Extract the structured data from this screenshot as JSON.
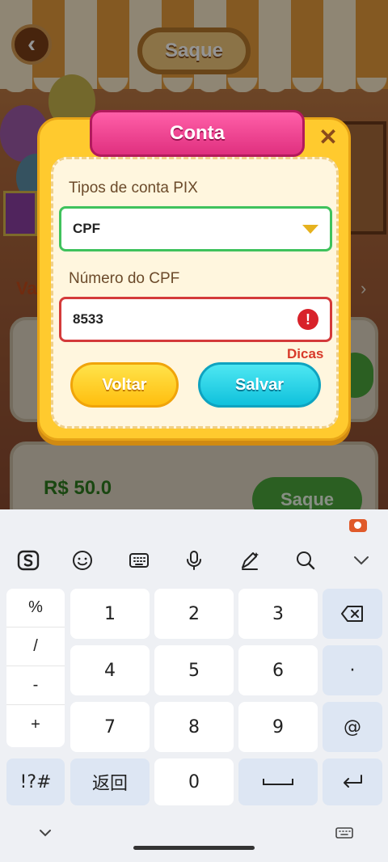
{
  "game": {
    "title": "Saque",
    "partial_label": "Va",
    "card_price": "R$ 50.0",
    "card_button": "Saque"
  },
  "dialog": {
    "title": "Conta",
    "account_type_label": "Tipos de conta PIX",
    "account_type_value": "CPF",
    "cpf_label": "Número do CPF",
    "cpf_value": "8533",
    "hint": "Dicas",
    "back_button": "Voltar",
    "save_button": "Salvar"
  },
  "keyboard": {
    "side_keys": [
      "%",
      "/",
      "-",
      "+"
    ],
    "rows": [
      [
        "1",
        "2",
        "3"
      ],
      [
        "4",
        "5",
        "6"
      ],
      [
        "7",
        "8",
        "9"
      ]
    ],
    "symbols_key": "!?#",
    "return_key": "返回",
    "zero_key": "0",
    "dot_key": "·",
    "at_key": "@"
  },
  "colors": {
    "ribbon": "#e0307f",
    "valid_border": "#3fc25c",
    "error_border": "#d43a3a",
    "salvar": "#10c1dc",
    "voltar": "#ffbe0f"
  }
}
